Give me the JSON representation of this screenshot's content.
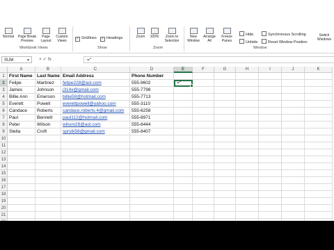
{
  "ribbon": {
    "workbook_views": {
      "group_label": "Workbook Views",
      "buttons": [
        "Normal",
        "Page Break Preview",
        "Page Layout",
        "Custom Views"
      ]
    },
    "show": {
      "group_label": "Show",
      "gridlines": "Gridlines",
      "headings": "Headings"
    },
    "zoom": {
      "group_label": "Zoom",
      "buttons": [
        "Zoom",
        "100%",
        "Zoom to Selection"
      ]
    },
    "window": {
      "group_label": "Window",
      "new_window": "New Window",
      "arrange_all": "Arrange All",
      "freeze_panes": "Freeze Panes",
      "split": "Split",
      "hide": "Hide",
      "unhide": "Unhide",
      "sync_scrolling": "Synchronous Scrolling",
      "reset_position": "Reset Window Position",
      "switch_windows": "Switch Windows"
    }
  },
  "formula_bar": {
    "name_box": "SUM",
    "fx": "× ✓ fx",
    "value": "=\""
  },
  "grid": {
    "columns": [
      "A",
      "B",
      "C",
      "D",
      "E",
      "F",
      "G",
      "H",
      "I",
      "J",
      "K"
    ],
    "row_numbers": [
      "1",
      "2",
      "3",
      "4",
      "5",
      "6",
      "7",
      "8",
      "9",
      "10",
      "11",
      "12",
      "13",
      "14",
      "15",
      "16",
      "17",
      "18",
      "19",
      "20",
      "21",
      "22"
    ],
    "headers": [
      "First Name",
      "Last Name",
      "Email Address",
      "Phone Number"
    ],
    "rows": [
      [
        "Felipe",
        "Martinez",
        "felipe228@aol.com",
        "555-9602"
      ],
      [
        "James",
        "Johnson",
        "j314x@gmail.com",
        "555-7798"
      ],
      [
        "Billie Ann",
        "Emerson",
        "billie59@hotmail.com",
        "555-7713"
      ],
      [
        "Everett",
        "Powell",
        "everettpowell@yahoo.com",
        "555-3110"
      ],
      [
        "Candace",
        "Roberts",
        "candace.roberts.4@gmail.com",
        "555-6258"
      ],
      [
        "Paul",
        "Bennett",
        "paul112@hotmail.com",
        "555-8971"
      ],
      [
        "Peter",
        "Wilson",
        "wilson29@aol.com",
        "555-8444"
      ],
      [
        "Stella",
        "Croft",
        "sprstk58@gmail.com",
        "555-8407"
      ]
    ],
    "active_cell_value": "=\"",
    "selected_column": "E",
    "selected_row": "2"
  }
}
